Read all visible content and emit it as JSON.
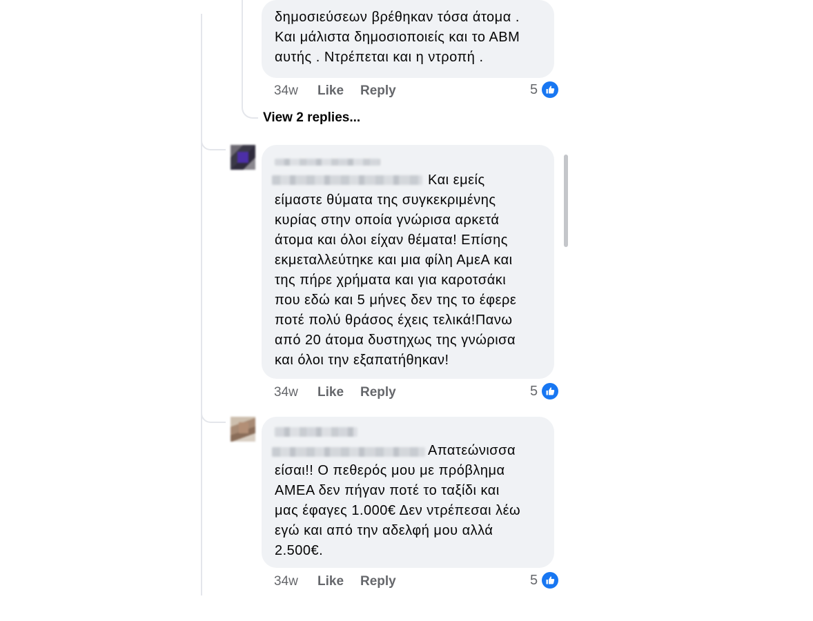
{
  "comments": [
    {
      "text": "δημοσιεύσεων βρέθηκαν τόσα άτομα .\nΚαι μάλιστα δημοσιοποιείς και το ΑΒΜ\nαυτής . Ντρέπεται και η ντροπή .",
      "time": "34w",
      "like_label": "Like",
      "reply_label": "Reply",
      "reaction_count": "5"
    },
    {
      "text_first": "Και εμείς",
      "text": "είμαστε θύματα της συγκεκριμένης\nκυρίας στην οποία γνώρισα αρκετά\nάτομα και όλοι είχαν θέματα! Επίσης\nεκμεταλλεύτηκε και μια φίλη ΑμεΑ και\nτης πήρε χρήματα και για καροτσάκι\nπου εδώ και 5 μήνες δεν της το έφερε\nποτέ πολύ θράσος έχεις τελικά!Πανω\nαπό 20 άτομα δυστηχως της γνώρισα\nκαι όλοι την εξαπατήθηκαν!",
      "time": "34w",
      "like_label": "Like",
      "reply_label": "Reply",
      "reaction_count": "5"
    },
    {
      "text_first": "Απατεώνισσα",
      "text": "είσαι!! Ο πεθερός μου με πρόβλημα\nΑΜΕΑ δεν πήγαν ποτέ το ταξίδι και\nμας έφαγες 1.000€ Δεν ντρέπεσαι λέω\nεγώ και από την αδελφή μου αλλά\n2.500€.",
      "time": "34w",
      "like_label": "Like",
      "reply_label": "Reply",
      "reaction_count": "5"
    }
  ],
  "view_replies_label": "View 2 replies...",
  "icons": {
    "reaction": "like-thumbs-up-icon"
  },
  "colors": {
    "like_blue": "#1877f2",
    "bubble": "#f0f2f5",
    "meta_text": "#65676b"
  }
}
